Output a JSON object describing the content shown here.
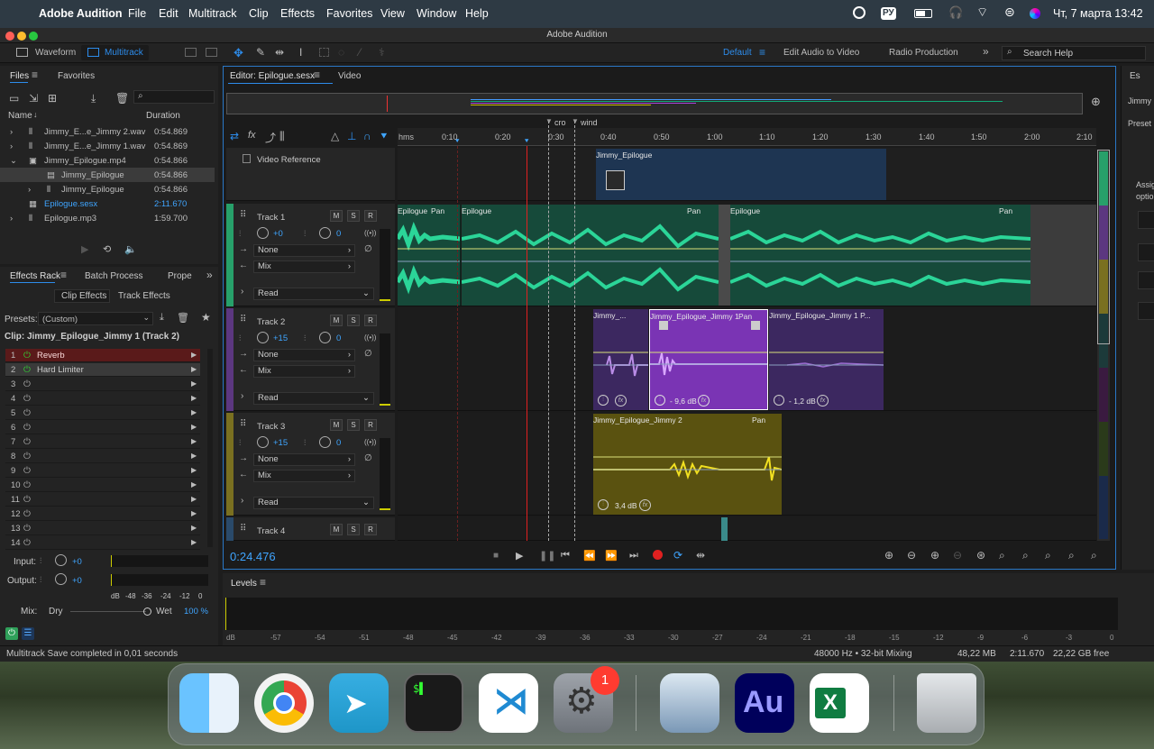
{
  "menubar": {
    "app": "Adobe Audition",
    "items": [
      "File",
      "Edit",
      "Multitrack",
      "Clip",
      "Effects",
      "Favorites",
      "View",
      "Window",
      "Help"
    ],
    "lang": "РУ",
    "datetime": "Чт, 7 марта 13:42"
  },
  "window": {
    "title": "Adobe Audition"
  },
  "toolbar": {
    "waveform": "Waveform",
    "multitrack": "Multitrack",
    "workspaces": [
      "Default",
      "Edit Audio to Video",
      "Radio Production"
    ],
    "search_placeholder": "Search Help"
  },
  "files": {
    "tab_files": "Files",
    "tab_favorites": "Favorites",
    "col_name": "Name",
    "col_duration": "Duration",
    "rows": [
      {
        "name": "Jimmy_E...e_Jimmy 2.wav",
        "dur": "0:54.869"
      },
      {
        "name": "Jimmy_E...e_Jimmy 1.wav",
        "dur": "0:54.869"
      },
      {
        "name": "Jimmy_Epilogue.mp4",
        "dur": "0:54.866"
      },
      {
        "name": "Jimmy_Epilogue",
        "dur": "0:54.866"
      },
      {
        "name": "Jimmy_Epilogue",
        "dur": "0:54.866"
      },
      {
        "name": "Epilogue.sesx",
        "dur": "2:11.670"
      },
      {
        "name": "Epilogue.mp3",
        "dur": "1:59.700"
      }
    ]
  },
  "effects": {
    "tab_rack": "Effects Rack",
    "tab_batch": "Batch Process",
    "tab_props": "Prope",
    "clip_effects": "Clip Effects",
    "track_effects": "Track Effects",
    "presets_label": "Presets:",
    "preset": "(Custom)",
    "clip_title": "Clip: Jimmy_Epilogue_Jimmy 1 (Track 2)",
    "slots": [
      "Reverb",
      "Hard Limiter",
      "",
      "",
      "",
      "",
      "",
      "",
      "",
      "",
      "",
      "",
      "",
      ""
    ],
    "input_label": "Input:",
    "input_val": "+0",
    "output_label": "Output:",
    "output_val": "+0",
    "meter_labels": [
      "dB",
      "-48",
      "-36",
      "-24",
      "-12",
      "0"
    ],
    "mix_label": "Mix:",
    "dry": "Dry",
    "wet": "Wet",
    "wet_val": "100 %"
  },
  "editor": {
    "tab": "Editor: Epilogue.sesx",
    "video_tab": "Video",
    "markers": [
      "cro",
      "wind"
    ],
    "ruler": [
      "hms",
      "0:10",
      "0:20",
      "0:30",
      "0:40",
      "0:50",
      "1:00",
      "1:10",
      "1:20",
      "1:30",
      "1:40",
      "1:50",
      "2:00",
      "2:10"
    ],
    "video_ref": "Video Reference",
    "video_clip": "Jimmy_Epilogue",
    "tracks": [
      {
        "name": "Track 1",
        "vol": "+0",
        "pan": "0",
        "input": "None",
        "output": "Mix",
        "mode": "Read"
      },
      {
        "name": "Track 2",
        "vol": "+15",
        "pan": "0",
        "input": "None",
        "output": "Mix",
        "mode": "Read"
      },
      {
        "name": "Track 3",
        "vol": "+15",
        "pan": "0",
        "input": "None",
        "output": "Mix",
        "mode": "Read"
      },
      {
        "name": "Track 4"
      }
    ],
    "clips": {
      "t1a": "Epilogue",
      "t1b": "Epilogue",
      "t1c": "Epilogue",
      "pan": "Pan",
      "t2a": "Jimmy_...",
      "t2b": "Jimmy_Epilogue_Jimmy 1",
      "t2c": "Jimmy_Epilogue_Jimmy 1 P...",
      "t2b_db": "- 9,6 dB",
      "t2c_db": "- 1,2 dB",
      "t3": "Jimmy_Epilogue_Jimmy 2",
      "t3_db": "3,4 dB",
      "fx": "fx"
    },
    "time": "0:24.476"
  },
  "levels": {
    "title": "Levels",
    "scale": [
      "dB",
      "-57",
      "-54",
      "-51",
      "-48",
      "-45",
      "-42",
      "-39",
      "-36",
      "-33",
      "-30",
      "-27",
      "-24",
      "-21",
      "-18",
      "-15",
      "-12",
      "-9",
      "-6",
      "-3",
      "0"
    ]
  },
  "status": {
    "left": "Multitrack Save completed in 0,01 seconds",
    "rate": "48000 Hz • 32-bit Mixing",
    "mem": "48,22 MB",
    "dur": "2:11.670",
    "free": "22,22 GB free"
  },
  "right": {
    "es": "Es",
    "jimmy": "Jimmy",
    "preset": "Preset",
    "assign": "Assig",
    "option": "optio"
  },
  "dock": {
    "badge": "1",
    "apps": [
      "finder-icon",
      "chrome-icon",
      "telegram-icon",
      "terminal-icon",
      "vscode-icon",
      "settings-icon",
      "preview-icon",
      "audition-icon",
      "excel-icon",
      "trash-icon"
    ]
  }
}
